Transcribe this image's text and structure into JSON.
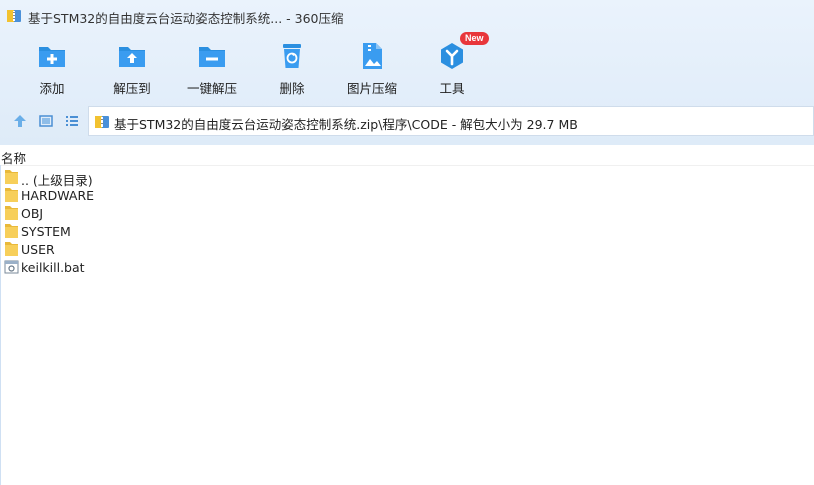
{
  "window": {
    "title": "基于STM32的自由度云台运动姿态控制系统... - 360压缩"
  },
  "toolbar": [
    {
      "label": "添加",
      "icon": "add-folder-icon"
    },
    {
      "label": "解压到",
      "icon": "extract-to-icon"
    },
    {
      "label": "一键解压",
      "icon": "one-click-extract-icon"
    },
    {
      "label": "删除",
      "icon": "delete-icon"
    },
    {
      "label": "图片压缩",
      "icon": "image-compress-icon"
    },
    {
      "label": "工具",
      "icon": "tools-icon",
      "badge": "New"
    }
  ],
  "nav": {
    "path": "基于STM32的自由度云台运动姿态控制系统.zip\\程序\\CODE - 解包大小为 29.7 MB"
  },
  "list": {
    "column_name": "名称",
    "items": [
      {
        "name": ".. (上级目录)",
        "type": "folder"
      },
      {
        "name": "HARDWARE",
        "type": "folder"
      },
      {
        "name": "OBJ",
        "type": "folder"
      },
      {
        "name": "SYSTEM",
        "type": "folder"
      },
      {
        "name": "USER",
        "type": "folder"
      },
      {
        "name": "keilkill.bat",
        "type": "bat"
      }
    ]
  },
  "colors": {
    "accent": "#2b8fe0",
    "header_bg": "#e6f0fb",
    "folder": "#f7cf5a",
    "badge": "#e8363b"
  }
}
